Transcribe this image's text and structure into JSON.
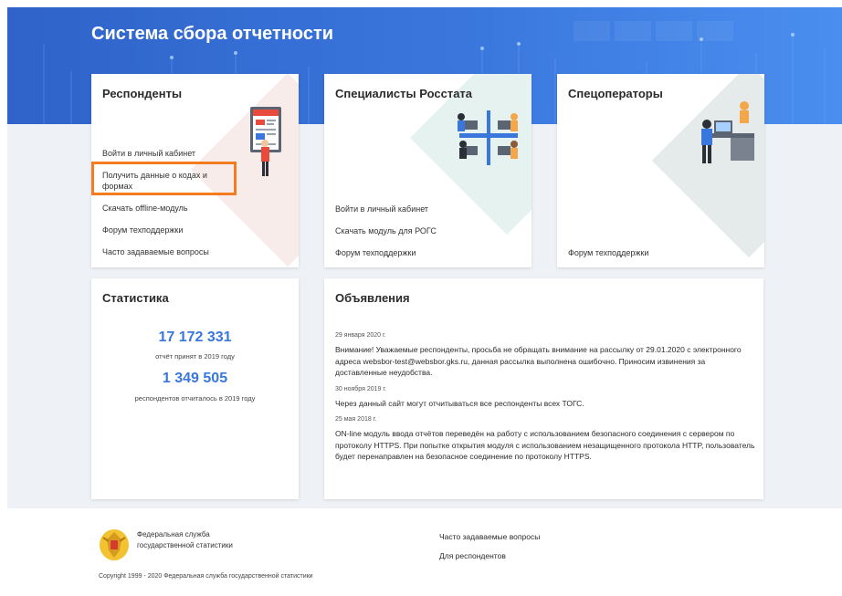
{
  "header": {
    "title": "Система сбора отчетности"
  },
  "cards": {
    "respondents": {
      "title": "Респонденты",
      "links": [
        "Войти в личный кабинет",
        "Получить данные о кодах и формах",
        "Скачать offline-модуль",
        "Форум техподдержки",
        "Часто задаваемые вопросы"
      ]
    },
    "rosstat": {
      "title": "Специалисты Росстата",
      "links": [
        "Войти в личный кабинет",
        "Скачать модуль для РОГС",
        "Форум техподдержки"
      ]
    },
    "operators": {
      "title": "Спецоператоры",
      "links": [
        "Форум техподдержки"
      ]
    }
  },
  "stats": {
    "title": "Статистика",
    "reports_count": "17 172 331",
    "reports_caption": "отчёт принят в 2019 году",
    "respondents_count": "1 349 505",
    "respondents_caption": "респондентов отчиталось в 2019 году"
  },
  "news": {
    "title": "Объявления",
    "items": [
      {
        "date": "29 января 2020 г.",
        "text": "Внимание! Уважаемые респонденты, просьба не обращать внимание на рассылку от 29.01.2020 с электронного адреса websbor-test@websbor.gks.ru, данная рассылка выполнена ошибочно. Приносим извинения за доставленные неудобства."
      },
      {
        "date": "30 ноября 2019 г.",
        "text": "Через данный сайт могут отчитываться все респонденты всех ТОГС."
      },
      {
        "date": "25 мая 2018 г.",
        "text": "ON-line модуль ввода отчётов переведён на работу с использованием безопасного соединения с сервером по протоколу HTTPS. При попытке открытия модуля с использованием незащищенного протокола HTTP, пользователь будет перенаправлен на безопасное соединение по протоколу HTTPS."
      }
    ]
  },
  "footer": {
    "org_line1": "Федеральная служба",
    "org_line2": "государственной статистики",
    "links": [
      "Часто задаваемые вопросы",
      "Для респондентов"
    ],
    "copyright": "Copyright 1999 - 2020 Федеральная служба государственной статистики"
  },
  "colors": {
    "header_blue": "#3a77dd",
    "accent_blue": "#3a77dd",
    "highlight_orange": "#f47b20",
    "page_gray": "#eef1f5"
  },
  "icons": {
    "respondents": "presentation-illustration",
    "rosstat": "office-workers-illustration",
    "operators": "operator-desk-illustration",
    "footer_logo": "rosstat-emblem-logo"
  }
}
